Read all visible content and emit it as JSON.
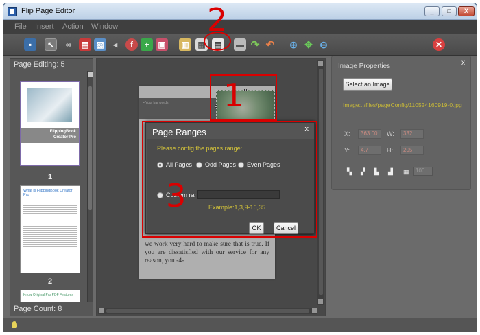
{
  "window": {
    "title": "Flip Page Editor",
    "controls": [
      "_",
      "□",
      "X"
    ]
  },
  "menu": [
    "File",
    "Insert",
    "Action",
    "Window"
  ],
  "toolbar": {
    "icons": [
      "save-icon",
      "pointer-icon",
      "link-icon",
      "video-icon",
      "image-icon",
      "sound-icon",
      "flash-icon",
      "add-icon",
      "page-icon",
      "copy-icon",
      "paste-icon",
      "page-ranges-icon",
      "delete-icon",
      "redo-icon",
      "undo-icon",
      "zoom-in-icon",
      "fit-icon",
      "zoom-out-icon",
      "close-icon"
    ]
  },
  "left_panel": {
    "page_editing_label": "Page Editing: 5",
    "page_count_label": "Page Count: 8",
    "thumbs": [
      {
        "num": "1",
        "brand1": "FlippingBook",
        "brand2": "Creator Pro"
      },
      {
        "num": "2",
        "heading": "What is FlippingBook Creator Pro"
      },
      {
        "num": "",
        "heading": "Know Original Pro PDF Features"
      }
    ]
  },
  "canvas": {
    "band_text": "• Your bar words",
    "body_text": "we work very hard to make sure that is true. If you are dissatisfied with our service for any reason, you -4-"
  },
  "dialog": {
    "title": "Page Ranges",
    "close": "x",
    "prompt": "Please config the pages range:",
    "options": [
      "All Pages",
      "Odd Pages",
      "Even Pages"
    ],
    "custom_label": "Custom range:",
    "custom_value": "",
    "example": "Example:1,3,9-16,35",
    "ok": "OK",
    "cancel": "Cancel",
    "selected": "All Pages"
  },
  "properties": {
    "title": "Image Properties",
    "close": "x",
    "select_button": "Select an Image",
    "image_path": "Image:../files/pageConfig/110524160919-0.jpg",
    "x_label": "X:",
    "x_value": "363.00",
    "w_label": "W:",
    "w_value": "332",
    "y_label": "Y:",
    "y_value": "4.7",
    "h_label": "H:",
    "h_value": "205",
    "opacity_value": "100"
  },
  "annotations": [
    "1",
    "2",
    "3"
  ],
  "colors": {
    "annotation": "#d90000",
    "prompt_yellow": "#d2c23a"
  }
}
